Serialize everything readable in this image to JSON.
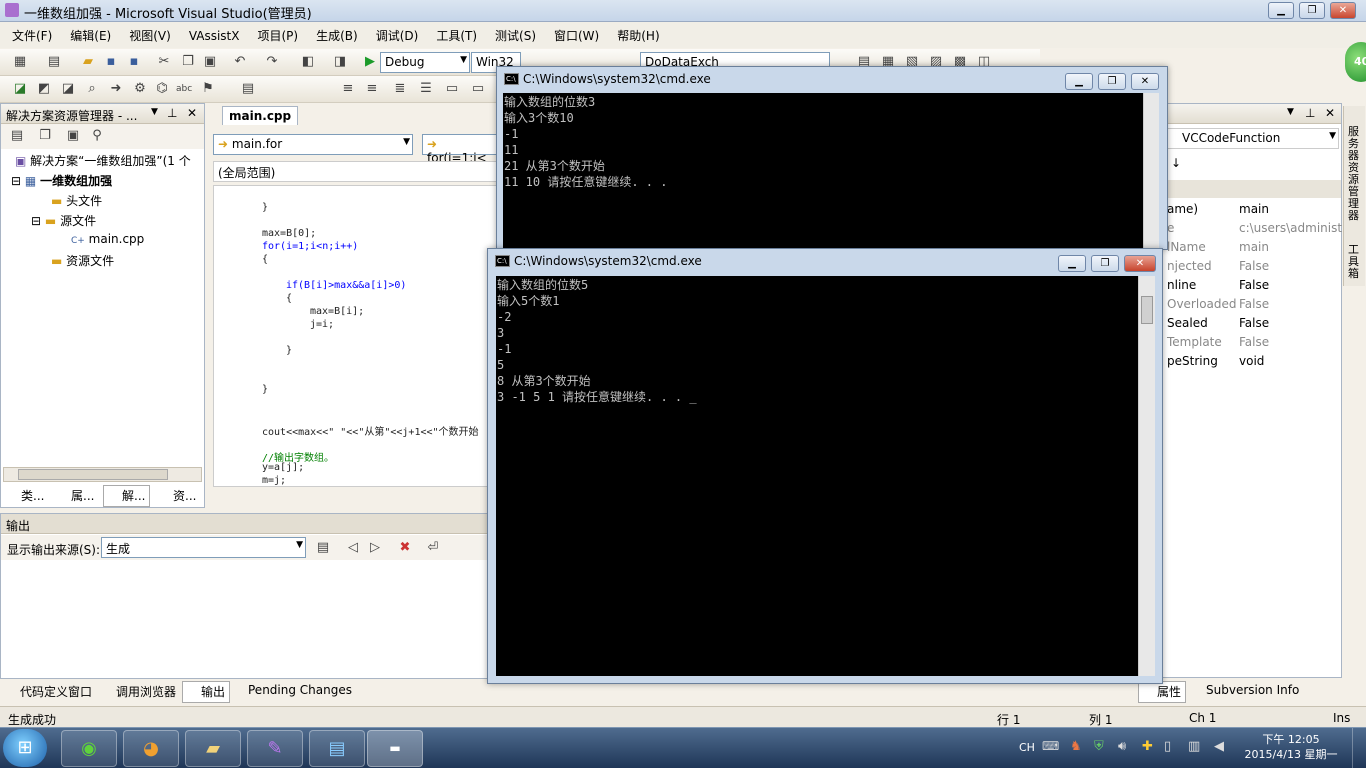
{
  "window": {
    "title": "一维数组加强 - Microsoft Visual Studio(管理员)"
  },
  "menu": [
    "文件(F)",
    "编辑(E)",
    "视图(V)",
    "VAssistX",
    "项目(P)",
    "生成(B)",
    "调试(D)",
    "工具(T)",
    "测试(S)",
    "窗口(W)",
    "帮助(H)"
  ],
  "toolbar": {
    "config": "Debug",
    "platform": "Win32",
    "find_text": "DoDataExch"
  },
  "solution_explorer": {
    "title": "解决方案资源管理器 - ...",
    "items": [
      "解决方案“一维数组加强”(1 个",
      "一维数组加强",
      "头文件",
      "源文件",
      "main.cpp",
      "资源文件"
    ],
    "tabs": [
      "类...",
      "属...",
      "解...",
      "资..."
    ]
  },
  "editor": {
    "tab": "main.cpp",
    "func_combo": "main.for",
    "scope_combo": "for(i=1;i<",
    "range_combo": "(全局范围)",
    "lines": [
      "}",
      "max=B[0];",
      "for(i=1;i<n;i++)",
      "{",
      "if(B[i]>max&&a[i]>0)",
      "{",
      "max=B[i];",
      "j=i;",
      "}",
      "}",
      "cout<<max<<\" \"<<\"从第\"<<j+1<<\"个数开始",
      "//输出字数组。",
      "y=a[j];",
      "m=j;"
    ]
  },
  "cmd1": {
    "title": "C:\\Windows\\system32\\cmd.exe",
    "lines": [
      "输入数组的位数3",
      "输入3个数10",
      "-1",
      "11",
      "21 从第3个数开始",
      "11 10 请按任意键继续. . ."
    ]
  },
  "cmd2": {
    "title": "C:\\Windows\\system32\\cmd.exe",
    "lines": [
      "输入数组的位数5",
      "输入5个数1",
      "-2",
      "3",
      "-1",
      "5",
      "8 从第3个数开始",
      "3 -1 5 1 请按任意键继续. . . _"
    ]
  },
  "properties": {
    "object": "VCCodeFunction",
    "rows": [
      {
        "name": "ame)",
        "value": "main"
      },
      {
        "name": "e",
        "value": "c:\\users\\administ"
      },
      {
        "name": "lName",
        "value": "main"
      },
      {
        "name": "njected",
        "value": "False"
      },
      {
        "name": "nline",
        "value": "False"
      },
      {
        "name": "Overloaded",
        "value": "False"
      },
      {
        "name": "Sealed",
        "value": "False"
      },
      {
        "name": "Template",
        "value": "False"
      },
      {
        "name": "peString",
        "value": "void"
      }
    ],
    "side_tabs": [
      "服务器资源管理器",
      "工具箱"
    ]
  },
  "output": {
    "title": "输出",
    "source_label": "显示输出来源(S):",
    "source_value": "生成"
  },
  "bottom_tabs": [
    "代码定义窗口",
    "调用浏览器",
    "输出",
    "Pending Changes"
  ],
  "right_bottom_tabs": [
    "属性",
    "Subversion Info"
  ],
  "status": {
    "message": "生成成功",
    "row": "行 1",
    "col": "列 1",
    "ch": "Ch 1",
    "mode": "Ins"
  },
  "badge": "40",
  "taskbar": {
    "lang": "CH",
    "time": "下午 12:05",
    "date": "2015/4/13 星期一"
  }
}
